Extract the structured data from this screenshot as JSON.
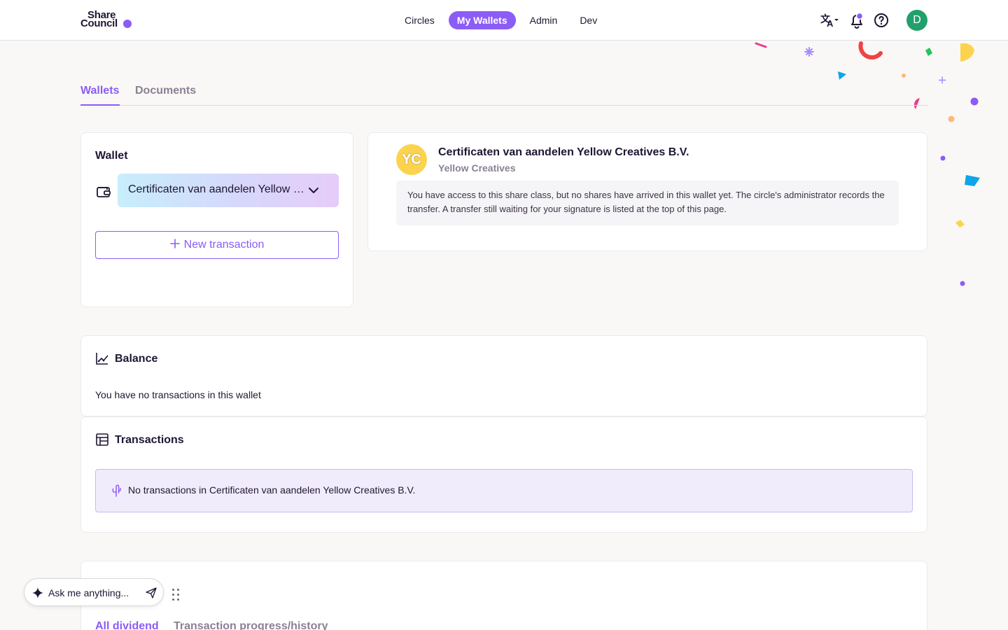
{
  "header": {
    "logo_line1": "Share",
    "logo_line2": "Council",
    "nav": [
      {
        "label": "Circles",
        "active": false
      },
      {
        "label": "My Wallets",
        "active": true
      },
      {
        "label": "Admin",
        "active": false
      },
      {
        "label": "Dev",
        "active": false
      }
    ],
    "user_initial": "D",
    "accent_color": "#8b5cf6"
  },
  "tabs": [
    {
      "label": "Wallets",
      "active": true
    },
    {
      "label": "Documents",
      "active": false
    }
  ],
  "wallet_card": {
    "title": "Wallet",
    "selected_wallet": "Certificaten van aandelen Yellow Creatives B.V.",
    "new_transaction_label": "New transaction"
  },
  "share_class": {
    "initials": "YC",
    "title": "Certificaten van aandelen Yellow Creatives B.V.",
    "subtitle": "Yellow Creatives",
    "notice": "You have access to this share class, but no shares have arrived in this wallet yet. The circle's administrator records the transfer. A transfer still waiting for your signature is listed at the top of this page."
  },
  "balance": {
    "title": "Balance",
    "empty_text": "You have no transactions in this wallet"
  },
  "transactions": {
    "title": "Transactions",
    "empty_text": "No transactions in Certificaten van aandelen Yellow Creatives B.V."
  },
  "dividend": {
    "tabs": [
      {
        "label": "All dividend",
        "active": true
      },
      {
        "label": "Transaction progress/history",
        "active": false
      }
    ]
  },
  "assistant": {
    "placeholder": "Ask me anything..."
  }
}
